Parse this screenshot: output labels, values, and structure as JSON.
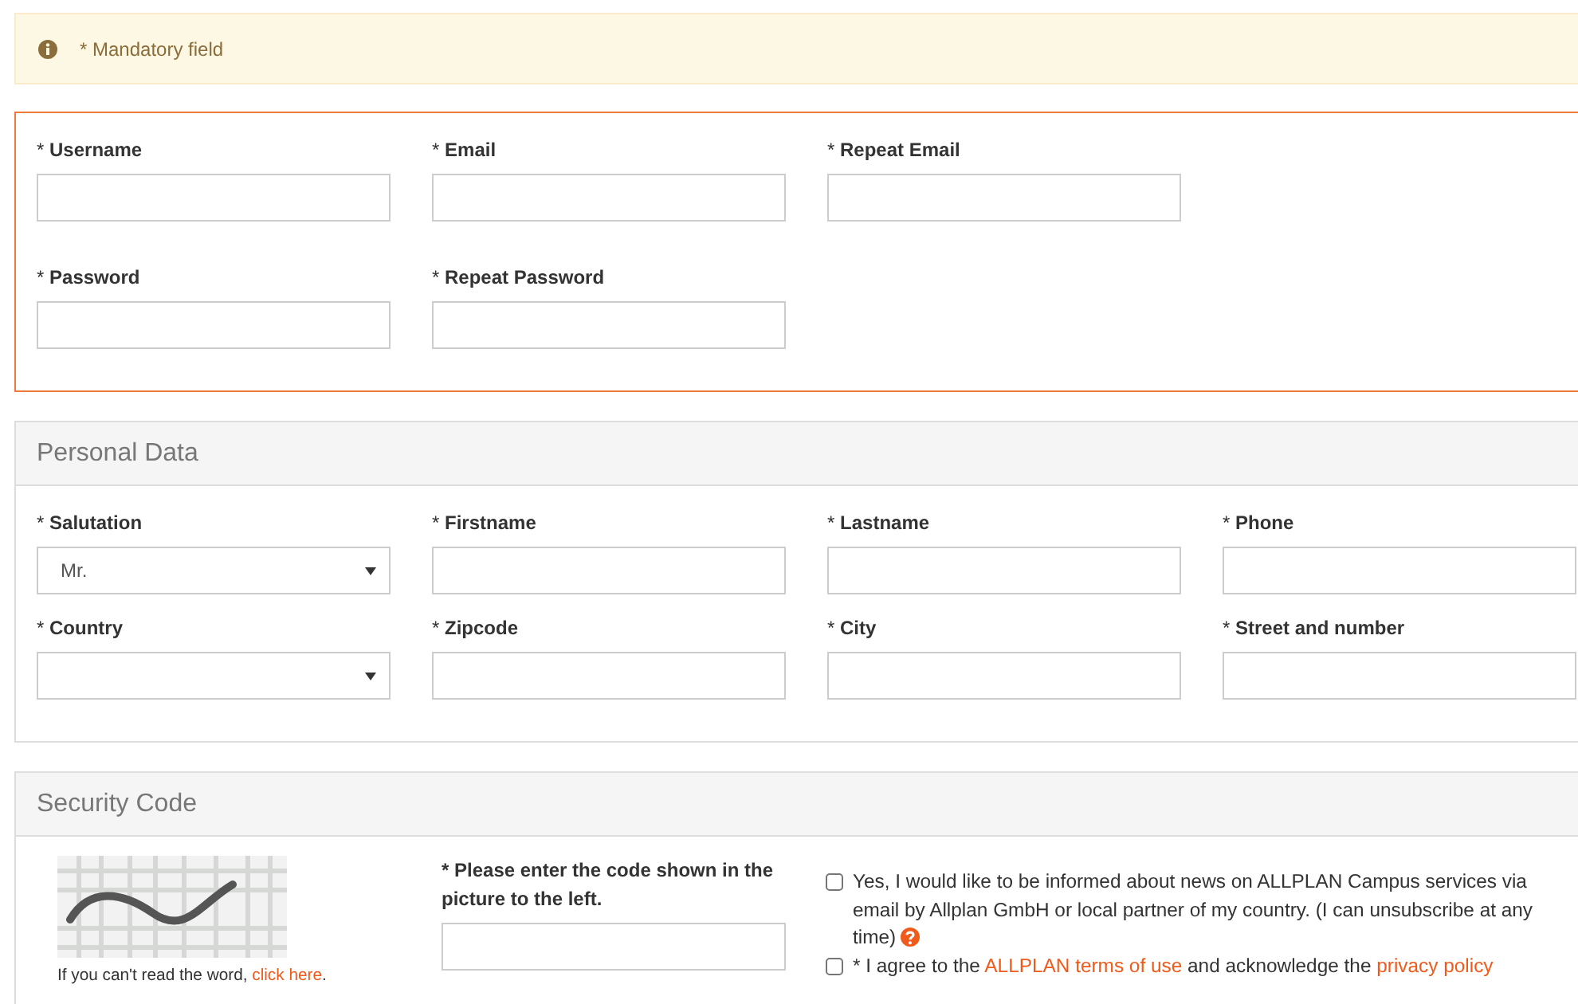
{
  "notice": {
    "text": "* Mandatory field"
  },
  "account": {
    "rows": [
      [
        {
          "label": "* **Username**",
          "kind": "text"
        },
        {
          "label": "* **Email**",
          "kind": "text"
        },
        {
          "label": "* **Repeat Email**",
          "kind": "text"
        }
      ],
      [
        {
          "label": "* **Password**",
          "kind": "text"
        },
        {
          "label": "* **Repeat Password**",
          "kind": "text"
        }
      ]
    ]
  },
  "personal": {
    "title": "Personal Data",
    "rows": [
      [
        {
          "label": "* **Salutation**",
          "kind": "select",
          "value": "Mr."
        },
        {
          "label": "* **Firstname**",
          "kind": "text"
        },
        {
          "label": "* **Lastname**",
          "kind": "text"
        },
        {
          "label": "* **Phone**",
          "kind": "text"
        }
      ],
      [
        {
          "label": "* **Country**",
          "kind": "select"
        },
        {
          "label": "* **Zipcode**",
          "kind": "text"
        },
        {
          "label": "* **City**",
          "kind": "text"
        },
        {
          "label": "* **Street and number**",
          "kind": "text"
        }
      ]
    ]
  },
  "security": {
    "title": "Security Code",
    "reload": [
      {
        "kind": "text",
        "text": "If you can't read the word, "
      },
      {
        "kind": "link",
        "text": "click here"
      },
      {
        "kind": "text",
        "text": "."
      }
    ],
    "code_label": "* Please enter the code shown in the picture to the left.",
    "consents": [
      {
        "checked": false,
        "help": true,
        "parts": [
          {
            "kind": "text",
            "text": "Yes, I would like to be informed about news on ALLPLAN Campus services via email by Allplan GmbH or local partner of my country. (I can unsubscribe at any time)"
          }
        ]
      },
      {
        "checked": false,
        "help": false,
        "parts": [
          {
            "kind": "text",
            "text": "* I agree to the "
          },
          {
            "kind": "link",
            "text": "ALLPLAN terms of use"
          },
          {
            "kind": "text",
            "text": " and acknowledge the "
          },
          {
            "kind": "link",
            "text": "privacy policy"
          }
        ]
      }
    ]
  }
}
